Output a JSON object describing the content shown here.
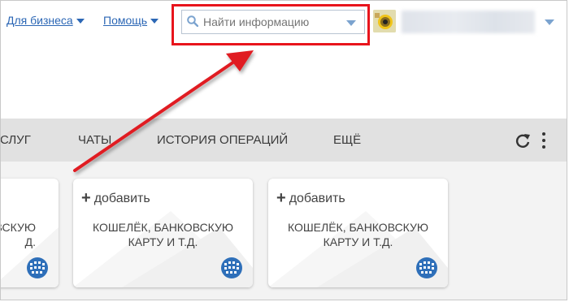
{
  "header": {
    "links": [
      {
        "label": "Для бизнеса"
      },
      {
        "label": "Помощь"
      }
    ],
    "search": {
      "placeholder": "Найти информацию"
    }
  },
  "menu": {
    "items": [
      "СЛУГ",
      "ЧАТЫ",
      "ИСТОРИЯ ОПЕРАЦИЙ",
      "ЕЩЁ"
    ]
  },
  "cards": [
    {
      "desc_lines": [
        "ВСКУЮ",
        "Д."
      ]
    },
    {
      "add_label": "добавить",
      "desc_lines": [
        "КОШЕЛЁК, БАНКОВСКУЮ",
        "КАРТУ И Т.Д."
      ]
    },
    {
      "add_label": "добавить",
      "desc_lines": [
        "КОШЕЛЁК, БАНКОВСКУЮ",
        "КАРТУ И Т.Д."
      ]
    }
  ],
  "colors": {
    "link": "#2c67b5",
    "highlight": "#e8141c",
    "menubar": "#e1e1e1",
    "brand_globe": "#2e6fb9"
  },
  "icons": [
    "search-icon",
    "chevron-down-icon",
    "avatar",
    "refresh-icon",
    "more-vert-icon",
    "plus-icon",
    "webmoney-globe-icon",
    "arrow-annotation"
  ]
}
